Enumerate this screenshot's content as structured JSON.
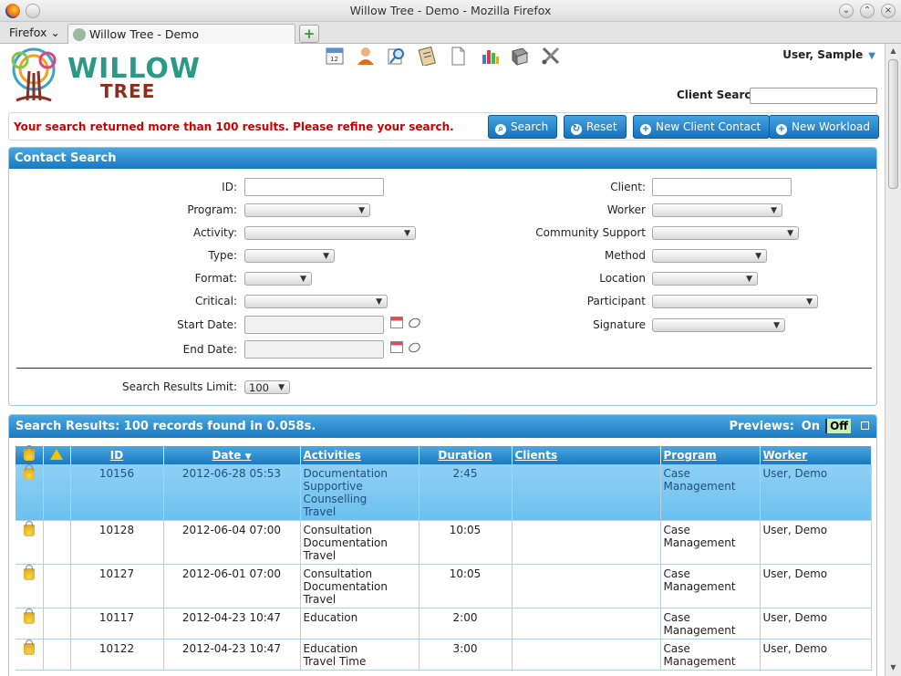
{
  "window": {
    "title": "Willow Tree - Demo - Mozilla Firefox"
  },
  "browser": {
    "menu_label": "Firefox",
    "tab_title": "Willow Tree - Demo",
    "new_tab_symbol": "+"
  },
  "header": {
    "logo_line1": "WILLOW",
    "logo_line2": "TREE",
    "user_label": "User, Sample",
    "client_search_label": "Client Search",
    "client_search_value": ""
  },
  "actionbar": {
    "error_message": "Your search returned more than 100 results. Please refine your search.",
    "buttons": {
      "search": "Search",
      "reset": "Reset",
      "new_client_contact": "New Client Contact",
      "new_workload": "New Workload"
    }
  },
  "contact_search": {
    "title": "Contact Search",
    "labels": {
      "id": "ID:",
      "program": "Program:",
      "activity": "Activity:",
      "type": "Type:",
      "format": "Format:",
      "critical": "Critical:",
      "start_date": "Start Date:",
      "end_date": "End Date:",
      "client": "Client:",
      "worker": "Worker",
      "community_support": "Community Support",
      "method": "Method",
      "location": "Location",
      "participant": "Participant",
      "signature": "Signature",
      "results_limit": "Search Results Limit:"
    },
    "results_limit_value": "100"
  },
  "results": {
    "title": "Search Results: 100 records found in 0.058s.",
    "previews_label": "Previews:",
    "previews_on": "On",
    "previews_off": "Off",
    "columns": {
      "id": "ID",
      "date": "Date",
      "activities": "Activities",
      "duration": "Duration",
      "clients": "Clients",
      "program": "Program",
      "worker": "Worker"
    },
    "rows": [
      {
        "id": "10156",
        "date": "2012-06-28 05:53",
        "activities": [
          "Documentation",
          "Supportive",
          "Counselling",
          "Travel"
        ],
        "duration": "2:45",
        "clients": "",
        "program": [
          "Case",
          "Management"
        ],
        "worker": "User, Demo",
        "selected": true
      },
      {
        "id": "10128",
        "date": "2012-06-04 07:00",
        "activities": [
          "Consultation",
          "Documentation",
          "Travel"
        ],
        "duration": "10:05",
        "clients": "",
        "program": [
          "Case",
          "Management"
        ],
        "worker": "User, Demo",
        "selected": false
      },
      {
        "id": "10127",
        "date": "2012-06-01 07:00",
        "activities": [
          "Consultation",
          "Documentation",
          "Travel"
        ],
        "duration": "10:05",
        "clients": "",
        "program": [
          "Case",
          "Management"
        ],
        "worker": "User, Demo",
        "selected": false
      },
      {
        "id": "10117",
        "date": "2012-04-23 10:47",
        "activities": [
          "Education"
        ],
        "duration": "2:00",
        "clients": "",
        "program": [
          "Case",
          "Management"
        ],
        "worker": "User, Demo",
        "selected": false
      },
      {
        "id": "10122",
        "date": "2012-04-23 10:47",
        "activities": [
          "Education",
          "Travel Time"
        ],
        "duration": "3:00",
        "clients": "",
        "program": [
          "Case",
          "Management"
        ],
        "worker": "User, Demo",
        "selected": false
      }
    ]
  },
  "colors": {
    "accent": "#1a79c2",
    "error": "#cc0000",
    "brand_green": "#2a9a86",
    "brand_brown": "#8a2e1f"
  }
}
